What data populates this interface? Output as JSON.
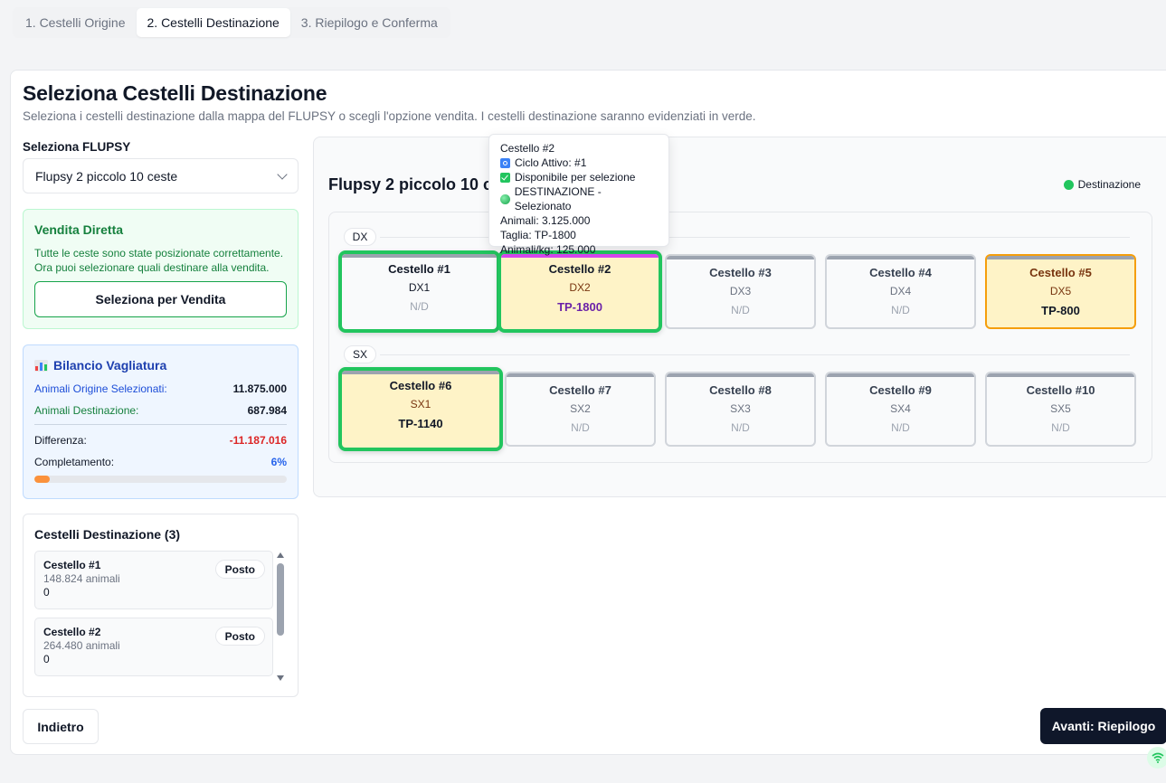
{
  "tabs": [
    {
      "label": "1. Cestelli Origine"
    },
    {
      "label": "2. Cestelli Destinazione"
    },
    {
      "label": "3. Riepilogo e Conferma"
    }
  ],
  "header": {
    "title": "Seleziona Cestelli Destinazione",
    "subtitle": "Seleziona i cestelli destinazione dalla mappa del FLUPSY o scegli l'opzione vendita. I cestelli destinazione saranno evidenziati in verde."
  },
  "flupsy": {
    "label": "Seleziona FLUPSY",
    "selected": "Flupsy 2 piccolo 10 ceste"
  },
  "vendita": {
    "title": "Vendita Diretta",
    "text": "Tutte le ceste sono state posizionate correttamente. Ora puoi selezionare quali destinare alla vendita.",
    "button": "Seleziona per Vendita"
  },
  "bilancio": {
    "title": "Bilancio Vagliatura",
    "origine_label": "Animali Origine Selezionati:",
    "origine_value": "11.875.000",
    "destinazione_label": "Animali Destinazione:",
    "destinazione_value": "687.984",
    "differenza_label": "Differenza:",
    "differenza_value": "-11.187.016",
    "completamento_label": "Completamento:",
    "completamento_value": "6%",
    "completamento_fraction": 0.06,
    "colors": {
      "progress": "#fb923c",
      "negative": "#dc2626"
    }
  },
  "destinazioni": {
    "title": "Cestelli Destinazione (3)",
    "items": [
      {
        "name": "Cestello #1",
        "animals": "148.824 animali",
        "extra": "0",
        "badge": "Posto"
      },
      {
        "name": "Cestello #2",
        "animals": "264.480 animali",
        "extra": "0",
        "badge": "Posto"
      }
    ]
  },
  "map": {
    "title": "Flupsy 2 piccolo 10 ceste",
    "legend": "Destinazione",
    "legend_color": "#22c55e",
    "rows": [
      {
        "label": "DX",
        "baskets": [
          {
            "name": "Cestello #1",
            "pos": "DX1",
            "size": "N/D"
          },
          {
            "name": "Cestello #2",
            "pos": "DX2",
            "size": "TP-1800"
          },
          {
            "name": "Cestello #3",
            "pos": "DX3",
            "size": "N/D"
          },
          {
            "name": "Cestello #4",
            "pos": "DX4",
            "size": "N/D"
          },
          {
            "name": "Cestello #5",
            "pos": "DX5",
            "size": "TP-800"
          }
        ]
      },
      {
        "label": "SX",
        "baskets": [
          {
            "name": "Cestello #6",
            "pos": "SX1",
            "size": "TP-1140"
          },
          {
            "name": "Cestello #7",
            "pos": "SX2",
            "size": "N/D"
          },
          {
            "name": "Cestello #8",
            "pos": "SX3",
            "size": "N/D"
          },
          {
            "name": "Cestello #9",
            "pos": "SX4",
            "size": "N/D"
          },
          {
            "name": "Cestello #10",
            "pos": "SX5",
            "size": "N/D"
          }
        ]
      }
    ]
  },
  "tooltip": {
    "title": "Cestello #2",
    "ciclo": "Ciclo Attivo: #1",
    "disponibile": "Disponibile per selezione",
    "destinazione": "DESTINAZIONE - Selezionato",
    "animali": "Animali: 3.125.000",
    "taglia": "Taglia: TP-1800",
    "animali_kg": "Animali/kg: 125.000"
  },
  "footer": {
    "back": "Indietro",
    "next": "Avanti: Riepilogo"
  }
}
